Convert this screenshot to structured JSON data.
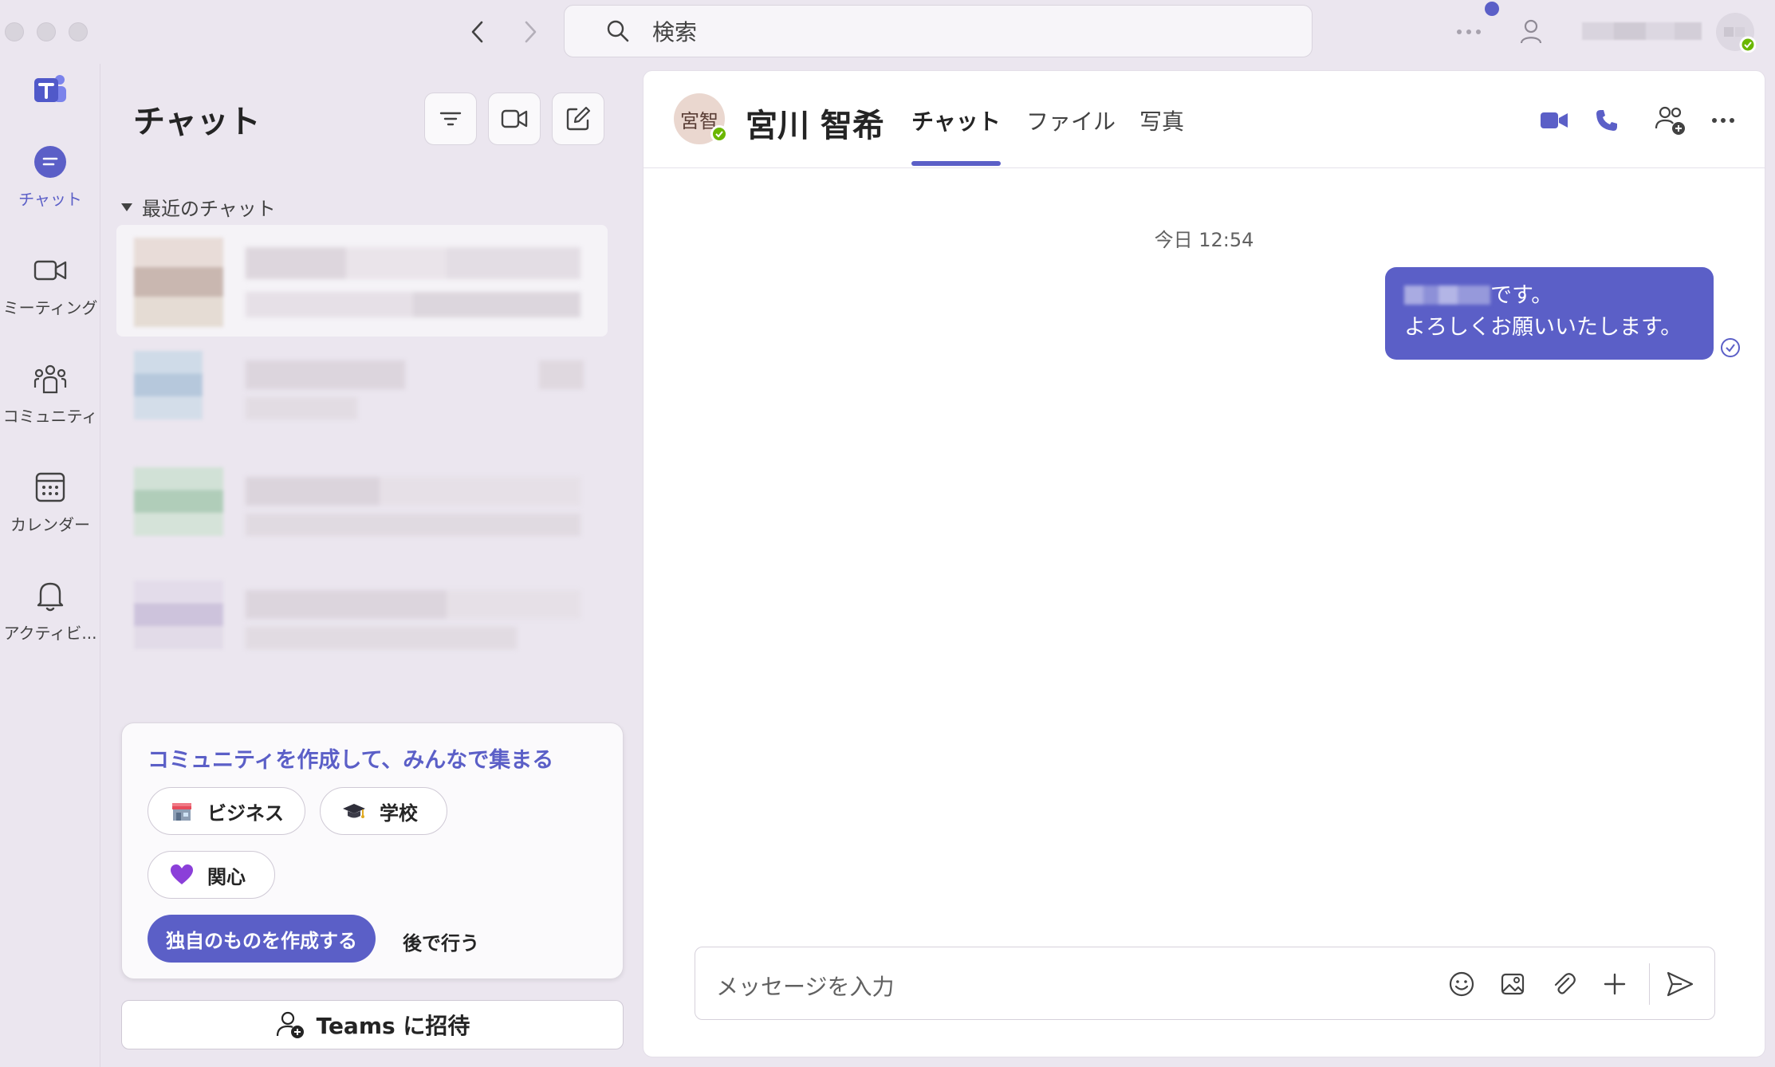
{
  "search": {
    "placeholder": "検索"
  },
  "rail": {
    "items": [
      {
        "label": "チャット",
        "icon": "chat-icon",
        "active": true
      },
      {
        "label": "ミーティング",
        "icon": "video-icon",
        "active": false
      },
      {
        "label": "コミュニティ",
        "icon": "community-icon",
        "active": false
      },
      {
        "label": "カレンダー",
        "icon": "calendar-icon",
        "active": false
      },
      {
        "label": "アクティビ...",
        "icon": "bell-icon",
        "active": false
      }
    ]
  },
  "chat_list": {
    "title": "チャット",
    "section_label": "最近のチャット"
  },
  "community_card": {
    "title": "コミュニティを作成して、みんなで集まる",
    "pills": [
      {
        "label": "ビジネス",
        "icon": "store-icon"
      },
      {
        "label": "学校",
        "icon": "graduation-cap-icon"
      },
      {
        "label": "関心",
        "icon": "heart-icon"
      }
    ],
    "create_label": "独自のものを作成する",
    "later_label": "後で行う"
  },
  "invite": {
    "label": "Teams に招待"
  },
  "conversation": {
    "avatar_initials": "宮智",
    "contact_name": "宮川 智希",
    "tabs": [
      {
        "label": "チャット",
        "active": true
      },
      {
        "label": "ファイル",
        "active": false
      },
      {
        "label": "写真",
        "active": false
      }
    ],
    "timestamp": "今日 12:54",
    "message": {
      "line1_suffix": "です。",
      "line2": "よろしくお願いいたします。"
    },
    "composer_placeholder": "メッセージを入力"
  },
  "colors": {
    "accent": "#5b5fc7",
    "presence_available": "#6bb700",
    "background": "#ebe6ef"
  }
}
